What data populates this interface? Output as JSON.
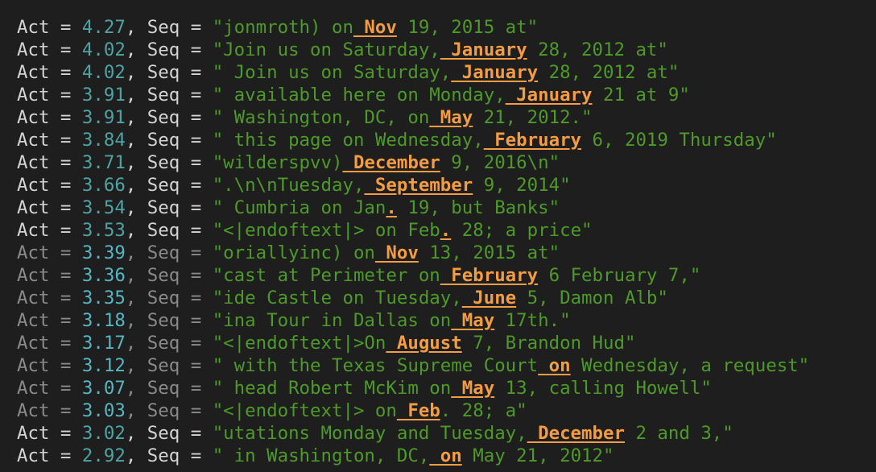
{
  "labels": {
    "act": "Act",
    "seq": "Seq",
    "eq": " = ",
    "comma": ", "
  },
  "colors": {
    "background": "#1e1e1e",
    "label": "#d4d4d4",
    "label_dim": "#8a8a8a",
    "activation": "#4fa3a3",
    "sequence": "#4e9a28",
    "highlight_token": "#f39c42"
  },
  "rows": [
    {
      "act": "4.27",
      "pre": "\"jonmroth) on",
      "tok": " Nov",
      "post": " 19, 2015 at\"",
      "dim": false
    },
    {
      "act": "4.02",
      "pre": "\"Join us on Saturday,",
      "tok": " January",
      "post": " 28, 2012 at\"",
      "dim": false
    },
    {
      "act": "4.02",
      "pre": "\" Join us on Saturday,",
      "tok": " January",
      "post": " 28, 2012 at\"",
      "dim": false
    },
    {
      "act": "3.91",
      "pre": "\" available here on Monday,",
      "tok": " January",
      "post": " 21 at 9\"",
      "dim": false
    },
    {
      "act": "3.91",
      "pre": "\" Washington, DC, on",
      "tok": " May",
      "post": " 21, 2012.\"",
      "dim": false
    },
    {
      "act": "3.84",
      "pre": "\" this page on Wednesday,",
      "tok": " February",
      "post": " 6, 2019 Thursday\"",
      "dim": false
    },
    {
      "act": "3.71",
      "pre": "\"wilderspvv)",
      "tok": " December",
      "post": " 9, 2016\\n\"",
      "dim": false
    },
    {
      "act": "3.66",
      "pre": "\".\\n\\nTuesday,",
      "tok": " September",
      "post": " 9, 2014\"",
      "dim": false
    },
    {
      "act": "3.54",
      "pre": "\" Cumbria on Jan",
      "tok": ".",
      "post": " 19, but Banks\"",
      "dim": false
    },
    {
      "act": "3.53",
      "pre": "\"<|endoftext|> on Feb",
      "tok": ".",
      "post": " 28; a price\"",
      "dim": false
    },
    {
      "act": "3.39",
      "pre": "\"oriallyinc) on",
      "tok": " Nov",
      "post": " 13, 2015 at\"",
      "dim": true
    },
    {
      "act": "3.36",
      "pre": "\"cast at Perimeter on",
      "tok": " February",
      "post": " 6 February 7,\"",
      "dim": true
    },
    {
      "act": "3.35",
      "pre": "\"ide Castle on Tuesday,",
      "tok": " June",
      "post": " 5, Damon Alb\"",
      "dim": true
    },
    {
      "act": "3.18",
      "pre": "\"ina Tour in Dallas on",
      "tok": " May",
      "post": " 17th.\"",
      "dim": true
    },
    {
      "act": "3.17",
      "pre": "\"<|endoftext|>On",
      "tok": " August",
      "post": " 7, Brandon Hud\"",
      "dim": true
    },
    {
      "act": "3.12",
      "pre": "\" with the Texas Supreme Court",
      "tok": " on",
      "post": " Wednesday, a request\"",
      "dim": true
    },
    {
      "act": "3.07",
      "pre": "\" head Robert McKim on",
      "tok": " May",
      "post": " 13, calling Howell\"",
      "dim": true
    },
    {
      "act": "3.03",
      "pre": "\"<|endoftext|> on",
      "tok": " Feb",
      "post": ". 28; a\"",
      "dim": true
    },
    {
      "act": "3.02",
      "pre": "\"utations Monday and Tuesday,",
      "tok": " December",
      "post": " 2 and 3,\"",
      "dim": false
    },
    {
      "act": "2.92",
      "pre": "\" in Washington, DC,",
      "tok": " on",
      "post": " May 21, 2012\"",
      "dim": false
    }
  ]
}
